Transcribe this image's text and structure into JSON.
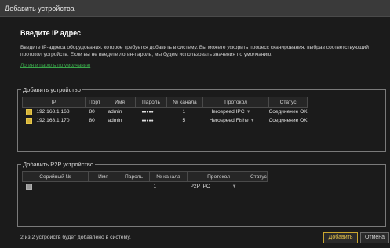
{
  "window": {
    "title": "Добавить устройства"
  },
  "heading": "Введите IP адрес",
  "description": "Введите IP-адреса оборудования, которое требуется добавить в систему. Вы можете ускорить процесс сканирования, выбрав соответствующий протокол устройств. Если вы не введете логин-пароль, мы будем использовать значения по умолчанию.",
  "link_text": "Логин и пароль по умолчанию",
  "ip_group": {
    "title": "Добавить устройство",
    "columns": [
      "IP",
      "Порт",
      "Имя",
      "Пароль",
      "№ канала",
      "Протокол",
      "Статус"
    ],
    "rows": [
      {
        "ip": "192.168.1.168",
        "port": "80",
        "name": "admin",
        "password": "●●●●●",
        "channel": "1",
        "protocol": "Herospeed,IPC",
        "status": "Соединение OK"
      },
      {
        "ip": "192.168.1.170",
        "port": "80",
        "name": "admin",
        "password": "●●●●●",
        "channel": "5",
        "protocol": "Herospeed,Fishe",
        "status": "Соединение OK"
      }
    ]
  },
  "p2p_group": {
    "title": "Добавить P2P устройство",
    "columns": [
      "Серийный №",
      "Имя",
      "Пароль",
      "№ канала",
      "Протокол",
      "Статус"
    ],
    "rows": [
      {
        "serial": "",
        "name": "",
        "password": "",
        "channel": "1",
        "protocol": "P2P IPC",
        "status": ""
      }
    ]
  },
  "footer": {
    "summary": "2 из 2 устройств будет добавлено в систему.",
    "add_label": "Добавить",
    "cancel_label": "Отмена"
  },
  "colors": {
    "accent": "#d4b23a",
    "ok": "#3aa64a",
    "background": "#1b1b1b"
  }
}
